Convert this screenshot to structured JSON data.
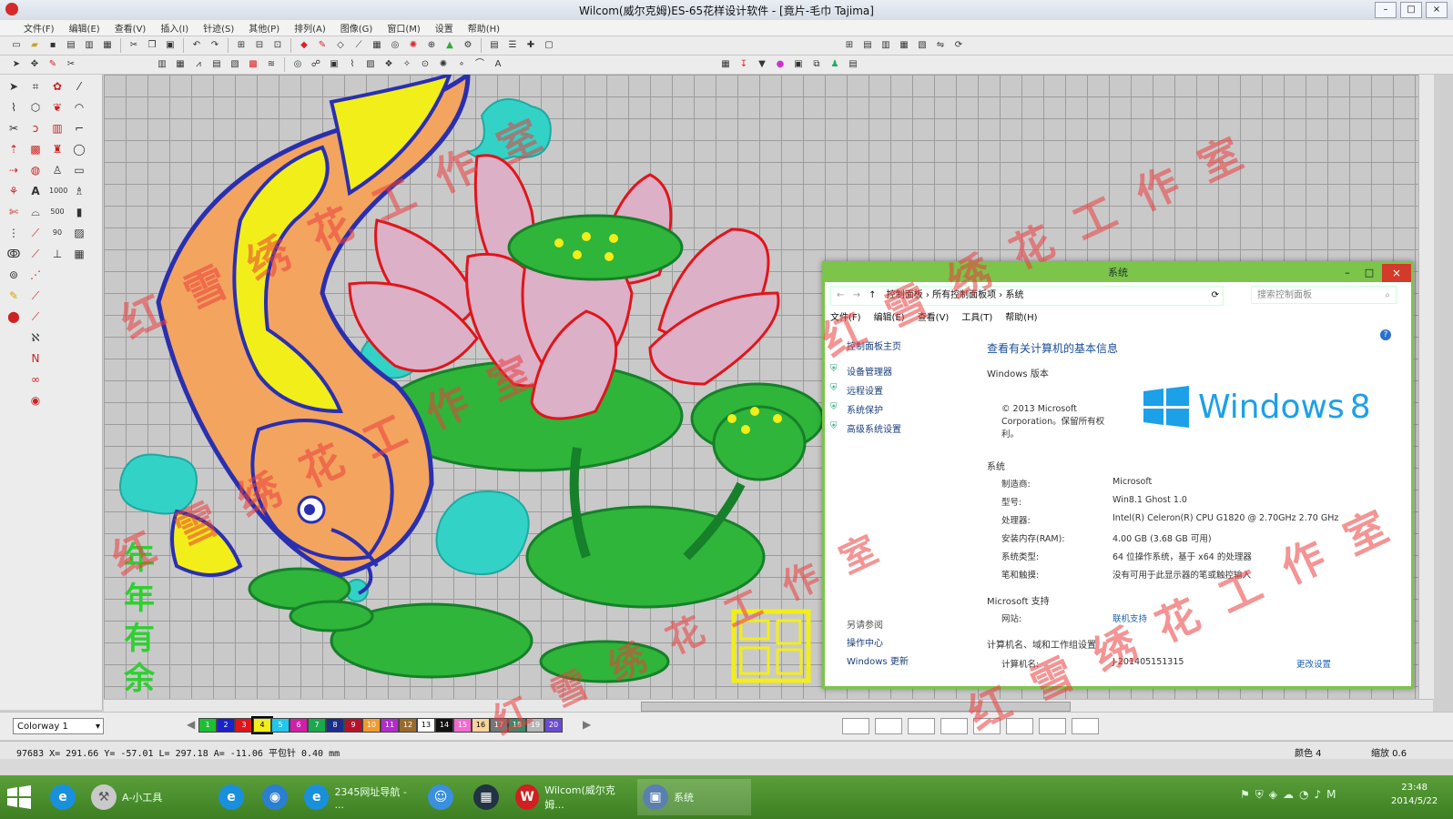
{
  "app": {
    "title": "Wilcom(威尔克姆)ES-65花样设计软件 - [竟片-毛巾         Tajima]",
    "menu": [
      "文件(F)",
      "编辑(E)",
      "查看(V)",
      "插入(I)",
      "针迹(S)",
      "其他(P)",
      "排列(A)",
      "图像(G)",
      "窗口(M)",
      "设置",
      "帮助(H)"
    ]
  },
  "colorbar": {
    "colorway": "Colorway 1",
    "swatches": [
      {
        "n": "1",
        "c": "#1dbf32"
      },
      {
        "n": "2",
        "c": "#1a22cc"
      },
      {
        "n": "3",
        "c": "#e0141a"
      },
      {
        "n": "4",
        "c": "#f2ee1a"
      },
      {
        "n": "5",
        "c": "#1ec8ee"
      },
      {
        "n": "6",
        "c": "#d21ea8"
      },
      {
        "n": "7",
        "c": "#19a84b"
      },
      {
        "n": "8",
        "c": "#1b2f8a"
      },
      {
        "n": "9",
        "c": "#b5122b"
      },
      {
        "n": "10",
        "c": "#f39a2e"
      },
      {
        "n": "11",
        "c": "#b22cc9"
      },
      {
        "n": "12",
        "c": "#9a6a2a"
      },
      {
        "n": "13",
        "c": "#ffffff"
      },
      {
        "n": "14",
        "c": "#111111"
      },
      {
        "n": "15",
        "c": "#f26ad0"
      },
      {
        "n": "16",
        "c": "#f6d49a"
      },
      {
        "n": "17",
        "c": "#777777"
      },
      {
        "n": "18",
        "c": "#3a8a6a"
      },
      {
        "n": "19",
        "c": "#b6b6b6"
      },
      {
        "n": "20",
        "c": "#6a4ad6"
      }
    ],
    "selected_index": 3
  },
  "status": {
    "coords": "97683  X=  291.66  Y=  -57.01  L=  297.18  A=  -11.06  平包针    0.40 mm",
    "color_label": "颜色 4",
    "zoom_label": "缩放 0.6"
  },
  "embroidery": {
    "vertical_text": [
      "年",
      "年",
      "有",
      "余"
    ],
    "watermark": "红雪绣花工作室"
  },
  "system_dialog": {
    "title": "系统",
    "address": [
      "控制面板",
      "所有控制面板项",
      "系统"
    ],
    "search_placeholder": "搜索控制面板",
    "menu": [
      "文件(F)",
      "编辑(E)",
      "查看(V)",
      "工具(T)",
      "帮助(H)"
    ],
    "left_links": [
      "控制面板主页",
      "设备管理器",
      "远程设置",
      "系统保护",
      "高级系统设置"
    ],
    "see_also_header": "另请参阅",
    "see_also": [
      "操作中心",
      "Windows 更新"
    ],
    "heading": "查看有关计算机的基本信息",
    "edition_header": "Windows 版本",
    "copyright": "© 2013 Microsoft Corporation。保留所有权利。",
    "logo_text": "Windows",
    "logo_version": "8",
    "system_header": "系统",
    "rows": [
      {
        "k": "制造商:",
        "v": "Microsoft"
      },
      {
        "k": "型号:",
        "v": "Win8.1 Ghost 1.0"
      },
      {
        "k": "处理器:",
        "v": "Intel(R) Celeron(R) CPU G1820 @ 2.70GHz   2.70 GHz"
      },
      {
        "k": "安装内存(RAM):",
        "v": "4.00 GB (3.68 GB 可用)"
      },
      {
        "k": "系统类型:",
        "v": "64 位操作系统，基于 x64 的处理器"
      },
      {
        "k": "笔和触摸:",
        "v": "没有可用于此显示器的笔或触控输入"
      }
    ],
    "support_header": "Microsoft 支持",
    "website_label": "网站:",
    "website_value": "联机支持",
    "computer_header": "计算机名、域和工作组设置",
    "computer_name_label": "计算机名:",
    "computer_name_value": "J-201405151315",
    "change_settings": "更改设置"
  },
  "taskbar": {
    "items": [
      {
        "label": "A-小工具"
      },
      {
        "label": "2345网址导航 - ..."
      },
      {
        "label": "Wilcom(威尔克姆..."
      },
      {
        "label": "系统"
      }
    ],
    "time": "23:48",
    "date": "2014/5/22"
  }
}
